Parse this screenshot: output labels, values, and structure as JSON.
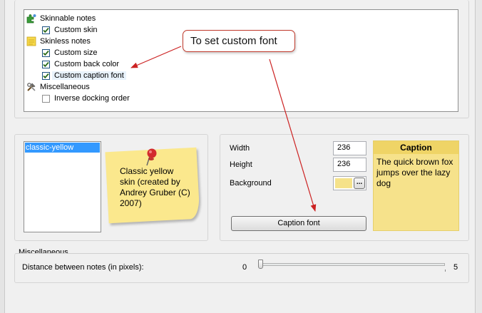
{
  "tree": {
    "items": [
      {
        "label": "Skinnable notes",
        "icon": "puzzle-icon",
        "checked": null
      },
      {
        "label": "Custom skin",
        "checked": true
      },
      {
        "label": "Skinless notes",
        "icon": "yellow-note-icon",
        "checked": null
      },
      {
        "label": "Custom size",
        "checked": true
      },
      {
        "label": "Custom back color",
        "checked": true
      },
      {
        "label": "Custom caption font",
        "checked": true
      },
      {
        "label": "Miscellaneous",
        "icon": "tools-icon",
        "checked": null
      },
      {
        "label": "Inverse docking order",
        "checked": false
      }
    ]
  },
  "callout": {
    "text": "To set custom font"
  },
  "skins": {
    "items": [
      "classic-yellow"
    ],
    "selected": "classic-yellow",
    "preview_text": "Classic yellow skin (created by Andrey Gruber (C) 2007)"
  },
  "props": {
    "width_label": "Width",
    "width_value": "236",
    "height_label": "Height",
    "height_value": "236",
    "background_label": "Background",
    "background_color": "#f5e28a",
    "browse_label": "...",
    "caption_font_label": "Caption font"
  },
  "preview": {
    "caption": "Caption",
    "body": "The quick brown fox jumps over the lazy dog"
  },
  "misc": {
    "group_label": "Miscellaneous",
    "distance_label": "Distance between notes (in pixels):",
    "slider_min": "0",
    "slider_max": "5",
    "slider_value": 0
  },
  "colors": {
    "arrow": "#cc2222",
    "selection": "#3399ff",
    "note": "#fbe88d"
  }
}
